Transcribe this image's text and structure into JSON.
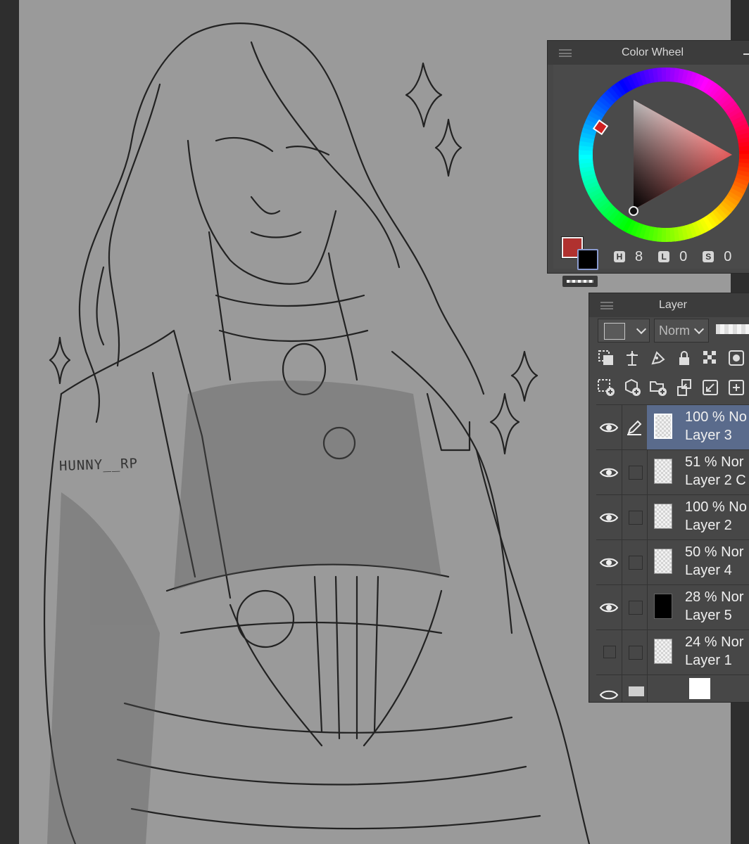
{
  "canvas": {
    "signature": "HUNNY__RP"
  },
  "color_wheel_panel": {
    "title": "Color Wheel",
    "main_color": "#b0312f",
    "sub_color": "#000000",
    "hls": [
      {
        "badge": "H",
        "value": "8"
      },
      {
        "badge": "L",
        "value": "0"
      },
      {
        "badge": "S",
        "value": "0"
      }
    ]
  },
  "layer_panel": {
    "title": "Layer",
    "blend_mode": "Norm",
    "layers": [
      {
        "opacity": "100 %",
        "mode": "No",
        "name": "Layer 3",
        "visible": true,
        "editing": true,
        "selected": true,
        "thumb": "checker"
      },
      {
        "opacity": "51 %",
        "mode": "Nor",
        "name": "Layer 2 C",
        "visible": true,
        "editing": false,
        "selected": false,
        "thumb": "checker"
      },
      {
        "opacity": "100 %",
        "mode": "No",
        "name": "Layer 2",
        "visible": true,
        "editing": false,
        "selected": false,
        "thumb": "checker"
      },
      {
        "opacity": "50 %",
        "mode": "Nor",
        "name": "Layer 4",
        "visible": true,
        "editing": false,
        "selected": false,
        "thumb": "checker"
      },
      {
        "opacity": "28 %",
        "mode": "Nor",
        "name": "Layer 5",
        "visible": true,
        "editing": false,
        "selected": false,
        "thumb": "black"
      },
      {
        "opacity": "24 %",
        "mode": "Nor",
        "name": "Layer 1",
        "visible": false,
        "editing": false,
        "selected": false,
        "thumb": "checker"
      }
    ]
  },
  "icons": [
    "clip-to-layer-below-icon",
    "set-reference-layer-icon",
    "set-draft-layer-icon",
    "lock-layer-icon",
    "lock-transparent-pixels-icon",
    "new-raster-layer-icon",
    "new-vector-layer-icon",
    "new-layer-folder-icon",
    "transfer-to-lower-layer-icon",
    "combine-with-layer-below-icon",
    "eye-icon",
    "pen-icon"
  ]
}
